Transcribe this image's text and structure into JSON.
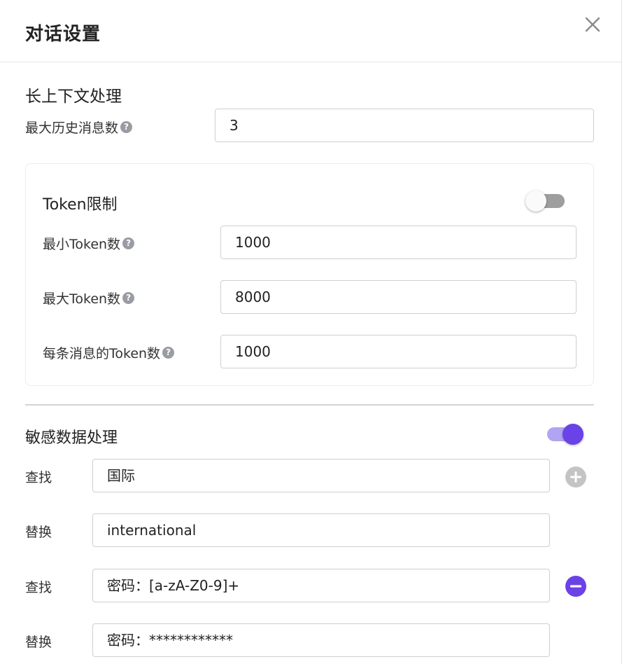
{
  "dialog": {
    "title": "对话设置",
    "close_icon": "close-icon"
  },
  "context": {
    "section_title": "长上下文处理",
    "max_history_label": "最大历史消息数",
    "max_history_value": "3"
  },
  "token_limit": {
    "title": "Token限制",
    "enabled": false,
    "min_label": "最小Token数",
    "min_value": "1000",
    "max_label": "最大Token数",
    "max_value": "8000",
    "per_msg_label": "每条消息的Token数",
    "per_msg_value": "1000"
  },
  "sensitive": {
    "title": "敏感数据处理",
    "enabled": true,
    "rules": [
      {
        "find_label": "查找",
        "find_value": "国际",
        "replace_label": "替换",
        "replace_value": "international",
        "action_icon": "add-circle-icon"
      },
      {
        "find_label": "查找",
        "find_value": "密码：[a-zA-Z0-9]+",
        "replace_label": "替换",
        "replace_value": "密码：************",
        "action_icon": "remove-circle-icon"
      }
    ]
  },
  "colors": {
    "accent": "#6a42e8",
    "accent_light": "#b1a4f2",
    "toggle_off": "#9e9e9e",
    "add_button": "#c4c4c4",
    "help_icon": "#9a9ca3"
  }
}
